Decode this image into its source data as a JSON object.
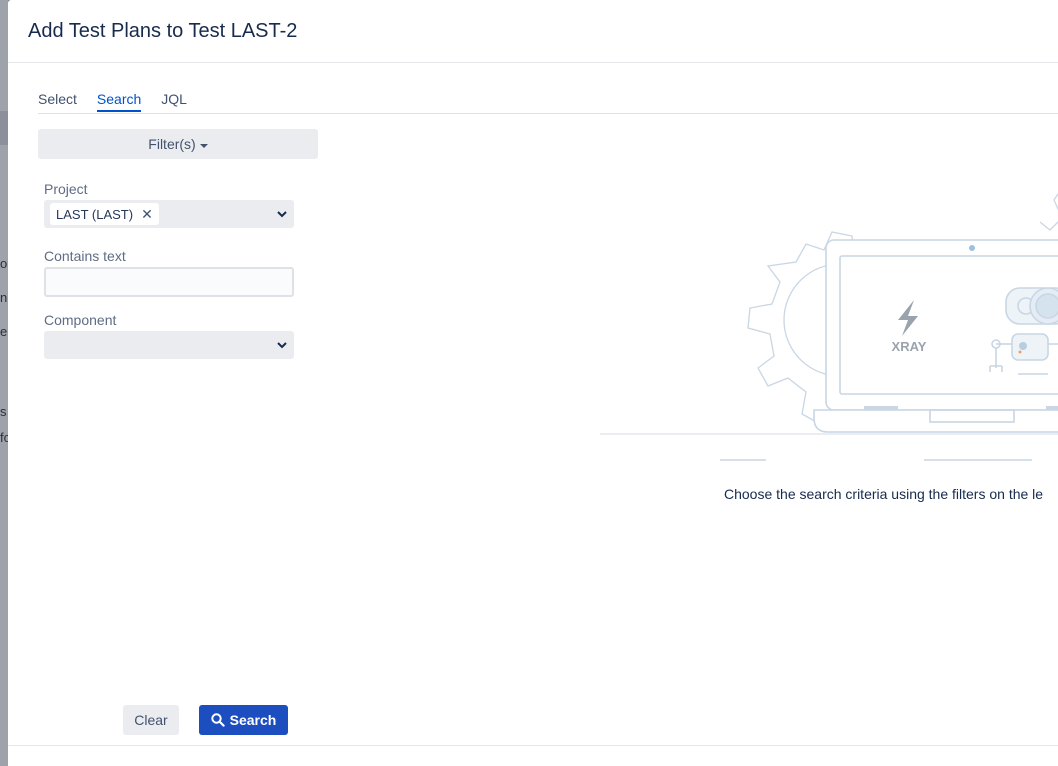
{
  "background": {
    "fragments": [
      "o",
      "n",
      "e",
      "s",
      "fo"
    ]
  },
  "dialog": {
    "title": "Add Test Plans to Test LAST-2"
  },
  "tabs": [
    {
      "label": "Select",
      "active": false
    },
    {
      "label": "Search",
      "active": true
    },
    {
      "label": "JQL",
      "active": false
    }
  ],
  "filters_button": {
    "label": "Filter(s)"
  },
  "fields": {
    "project": {
      "label": "Project",
      "selected_tag": "LAST (LAST)"
    },
    "contains_text": {
      "label": "Contains text",
      "value": "",
      "placeholder": ""
    },
    "component": {
      "label": "Component",
      "selected": ""
    }
  },
  "illustration": {
    "logo_text": "XRAY",
    "icon": "xray-lightning-icon"
  },
  "empty_message": "Choose the search criteria using the filters on the le",
  "buttons": {
    "clear": "Clear",
    "search": "Search"
  },
  "colors": {
    "primary": "#1d4ebf",
    "tab_active": "#0052cc",
    "line_art": "#c9d6e3"
  }
}
